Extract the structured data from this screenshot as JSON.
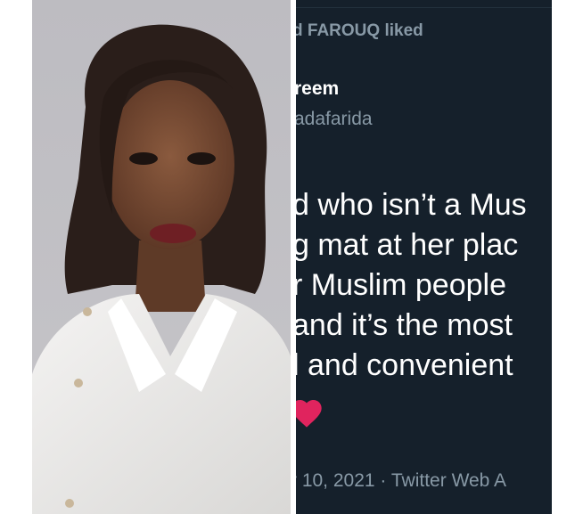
{
  "tweet": {
    "liked_by": "d FAROUQ liked",
    "author_name": "reem",
    "author_handle": "adafarida",
    "body_lines": [
      "d who isn’t a Mus",
      "g mat at her plac",
      "r Muslim people",
      "and it’s the most",
      "l and convenient"
    ],
    "timestamp": "r 10, 2021",
    "separator": "·",
    "source": "Twitter Web A"
  },
  "colors": {
    "tweet_background": "#15202b",
    "secondary_text": "#8899a6",
    "heart": "#e0245e"
  },
  "icons": {
    "heart": "heart-icon"
  }
}
